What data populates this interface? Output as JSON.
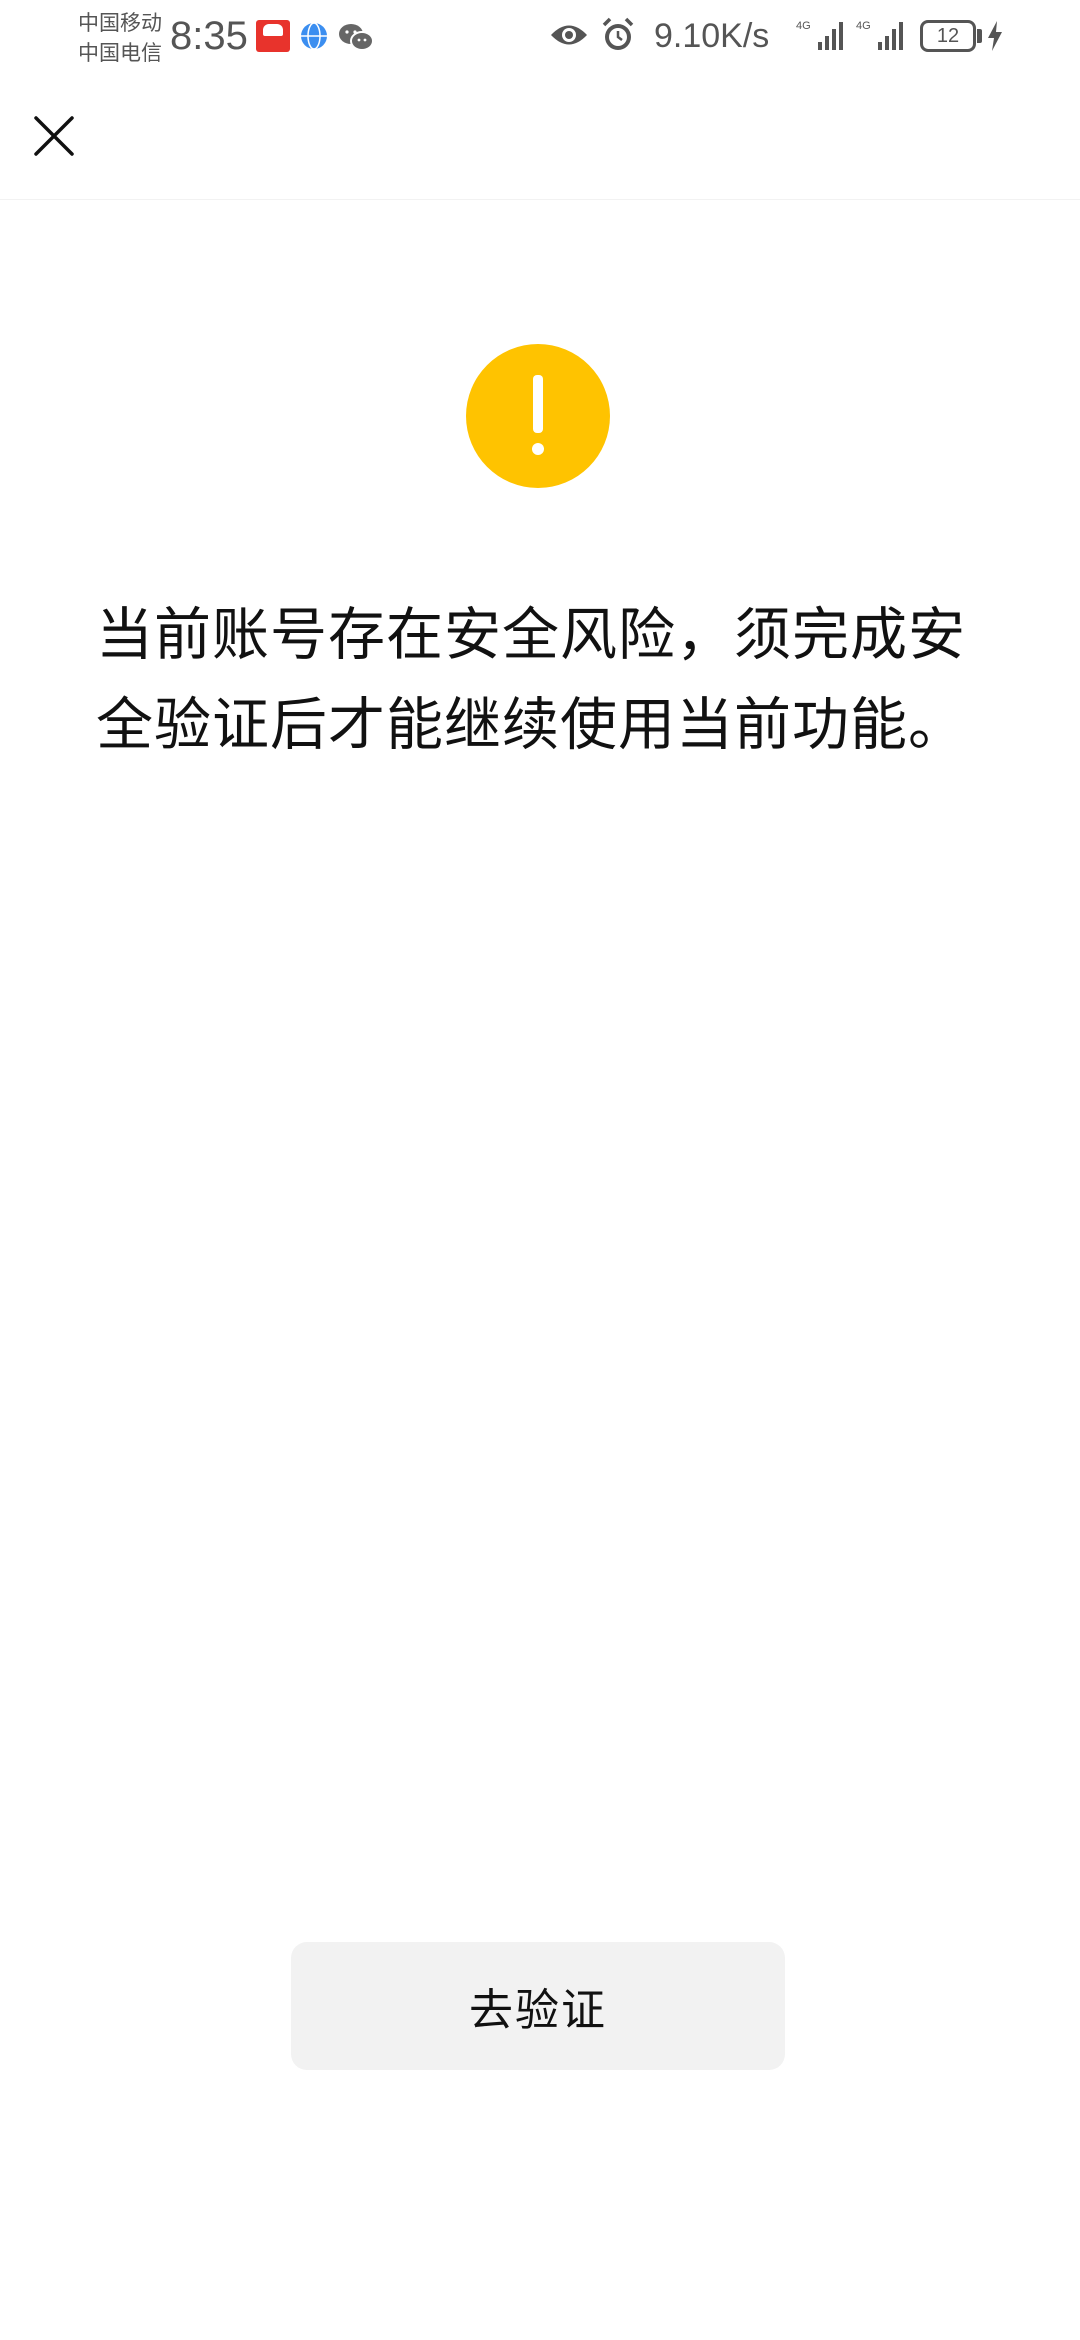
{
  "status_bar": {
    "carrier_1": "中国移动",
    "carrier_2": "中国电信",
    "time": "8:35",
    "net_speed": "9.10K/s",
    "battery_level": "12",
    "signal_1_label": "4G",
    "signal_2_label": "4G",
    "icons": [
      "app-badge-icon",
      "globe-icon",
      "wechat-icon",
      "eye-icon",
      "alarm-icon",
      "signal-icon",
      "signal-icon",
      "battery-icon",
      "charging-bolt-icon"
    ]
  },
  "nav": {
    "close_icon": "close-icon"
  },
  "content": {
    "warning_icon": "exclamation-icon",
    "warning_color": "#ffc300",
    "message": "当前账号存在安全风险，须完成安全验证后才能继续使用当前功能。"
  },
  "actions": {
    "verify_label": "去验证"
  }
}
